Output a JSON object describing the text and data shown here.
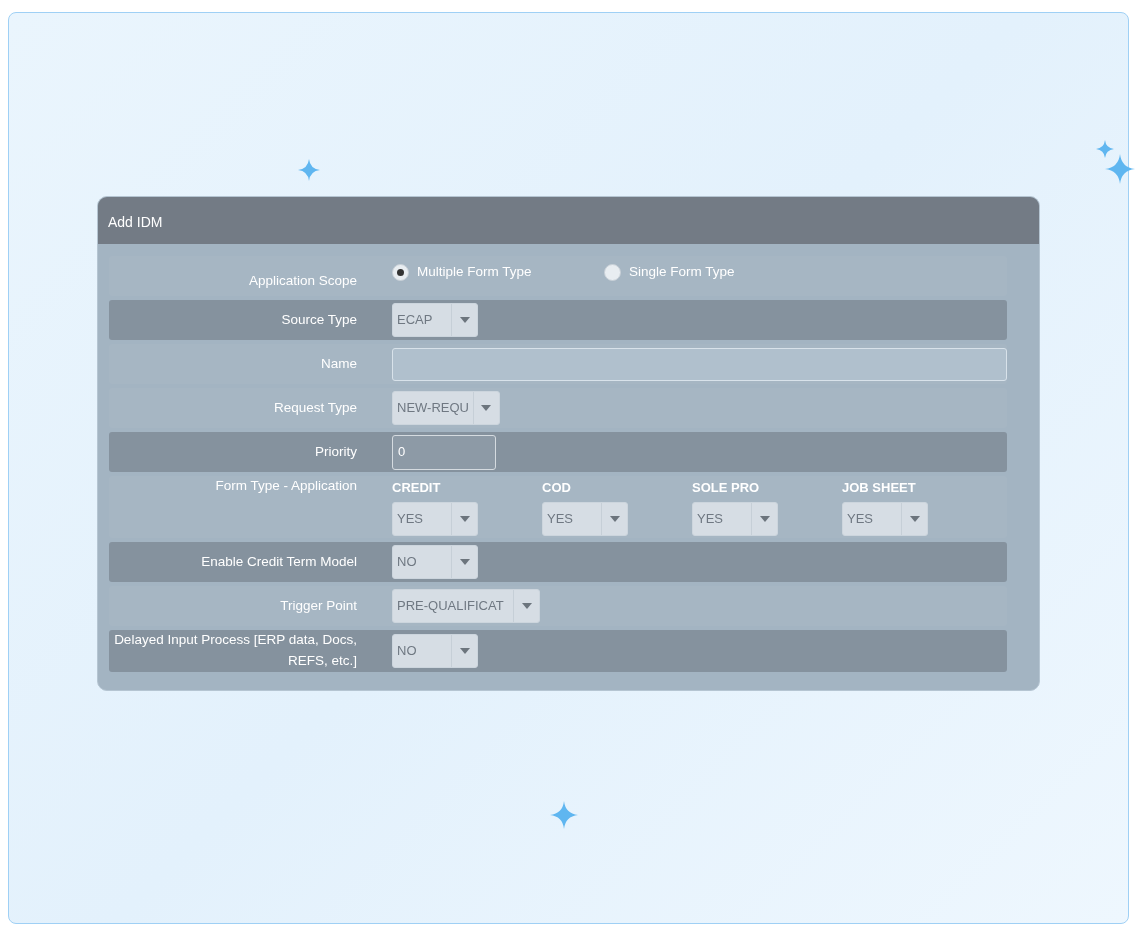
{
  "dialog": {
    "title": "Add IDM"
  },
  "rows": [
    {
      "kind": "radio",
      "label": "Application Scope",
      "banded": false,
      "options": [
        {
          "label": "Multiple Form Type",
          "selected": true
        },
        {
          "label": "Single Form Type",
          "selected": false
        }
      ]
    },
    {
      "kind": "select",
      "label": "Source Type",
      "banded": true,
      "value": "ECAP",
      "wide": false
    },
    {
      "kind": "text",
      "label": "Name",
      "banded": false
    },
    {
      "kind": "select",
      "label": "Request Type",
      "banded": false,
      "value": "NEW-REQU",
      "wide": false
    },
    {
      "kind": "number",
      "label": "Priority",
      "banded": true,
      "value": "0"
    },
    {
      "kind": "multi",
      "label": "Form Type - Application",
      "banded": false,
      "items": [
        {
          "heading": "CREDIT",
          "value": "YES"
        },
        {
          "heading": "COD",
          "value": "YES"
        },
        {
          "heading": "SOLE PRO",
          "value": "YES"
        },
        {
          "heading": "JOB SHEET",
          "value": "YES"
        }
      ]
    },
    {
      "kind": "select",
      "label": "Enable Credit Term Model",
      "banded": true,
      "value": "NO",
      "wide": false
    },
    {
      "kind": "select",
      "label": "Trigger Point",
      "banded": false,
      "value": "PRE-QUALIFICAT",
      "wide": true
    },
    {
      "kind": "select",
      "label": "Delayed Input Process [ERP data, Docs, REFS, etc.]",
      "banded": true,
      "value": "NO",
      "wide": false
    }
  ]
}
